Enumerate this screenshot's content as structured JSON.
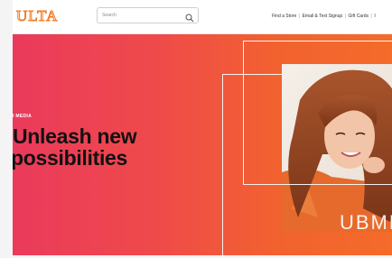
{
  "header": {
    "logo_text": "ULTA",
    "search": {
      "placeholder": "Search"
    },
    "links": [
      "Find a Store",
      "Email & Text Signup",
      "Gift Cards",
      "I"
    ]
  },
  "hero": {
    "eyebrow": "I MEDIA",
    "headline_line1": "Unleash new",
    "headline_line2": "possibilities",
    "watermark": "UBME"
  },
  "colors": {
    "brand_orange": "#f47a20",
    "hero_left": "#ea3a5c",
    "hero_right": "#f46b2a"
  }
}
